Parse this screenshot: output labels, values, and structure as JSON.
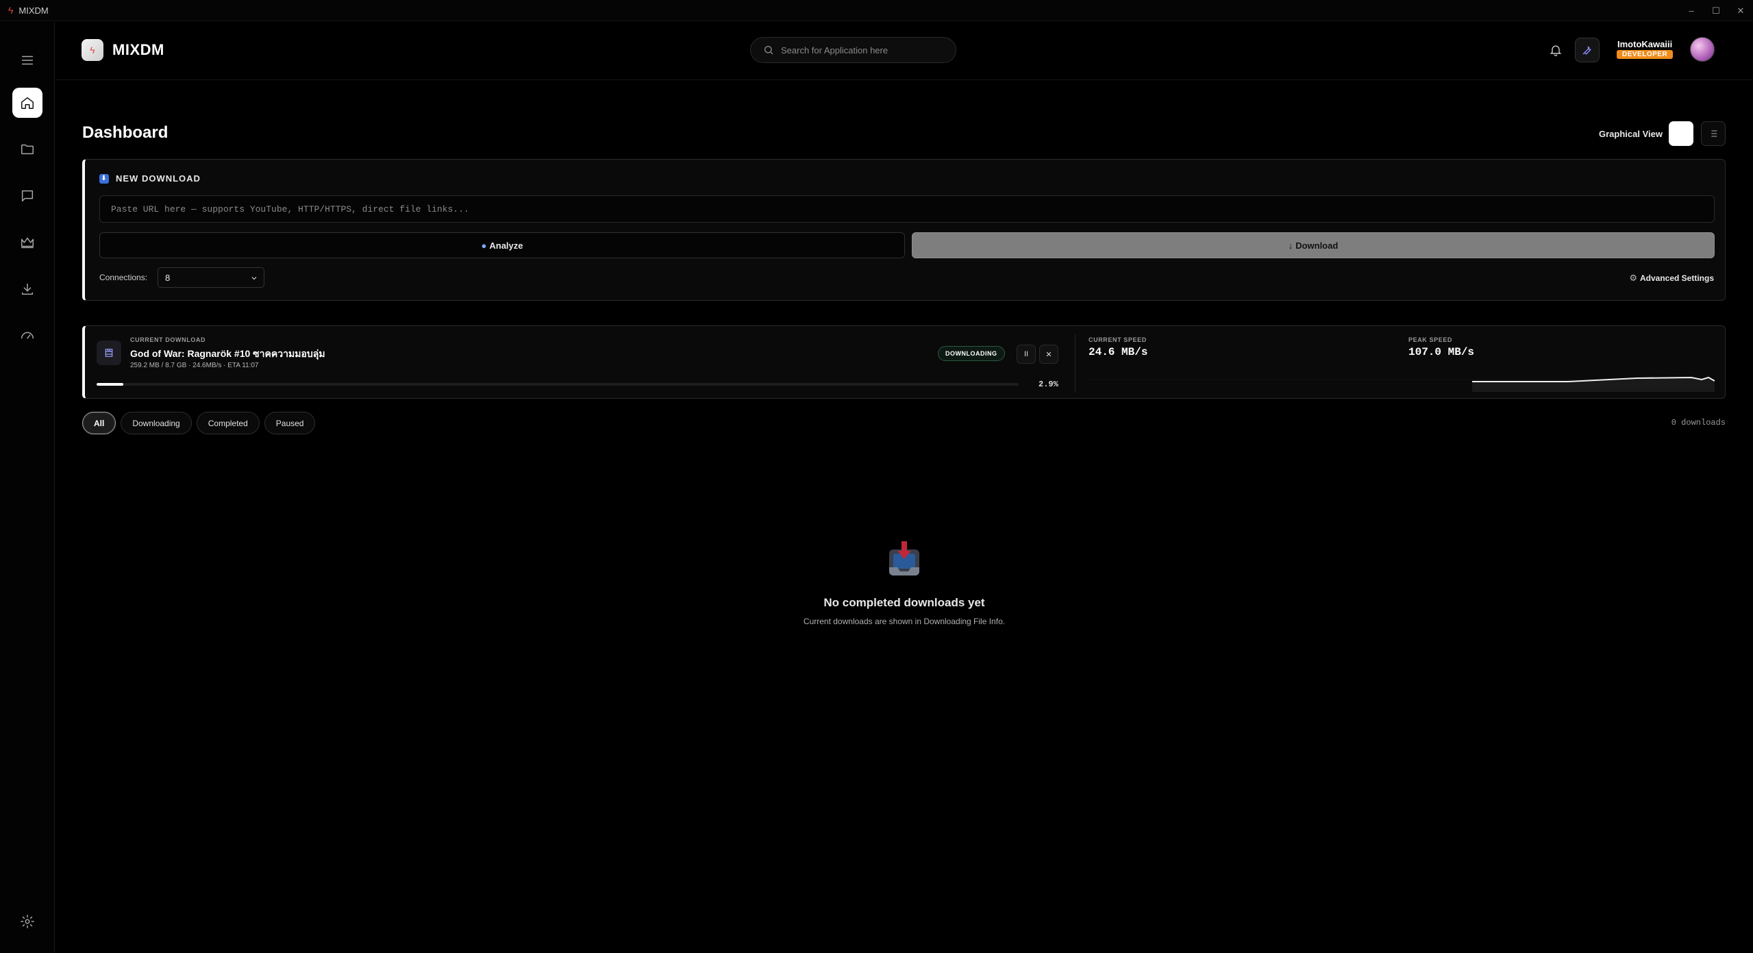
{
  "window": {
    "title": "MIXDM",
    "minimize": "–",
    "maximize": "☐",
    "close": "✕"
  },
  "header": {
    "brand": "MIXDM",
    "search_placeholder": "Search for Application here",
    "user_name": "ImotoKawaiii",
    "user_role": "DEVELOPER"
  },
  "sidebar": {
    "items": [
      "home-icon",
      "folder-icon",
      "chat-icon",
      "crown-icon",
      "download-icon",
      "speedometer-icon"
    ],
    "bottom": "gear-icon"
  },
  "page": {
    "title": "Dashboard",
    "view_label": "Graphical View"
  },
  "new_download": {
    "title": "NEW DOWNLOAD",
    "url_placeholder": "Paste URL here — supports YouTube, HTTP/HTTPS, direct file links...",
    "analyze_label": "Analyze",
    "download_label": "Download",
    "connections_label": "Connections:",
    "connections_value": "8",
    "advanced_label": "Advanced Settings"
  },
  "current_download": {
    "kicker": "CURRENT DOWNLOAD",
    "name": "God of War: Ragnarök #10 ซาคความมอบลุ่ม",
    "meta": "259.2 MB / 8.7 GB · 24.6MB/s · ETA 11:07",
    "status": "DOWNLOADING",
    "progress_percent": 2.9,
    "progress_text": "2.9%",
    "pause_label": "II",
    "cancel_label": "✕",
    "current_speed_label": "CURRENT SPEED",
    "current_speed": "24.6 MB/s",
    "peak_speed_label": "PEAK SPEED",
    "peak_speed": "107.0 MB/s"
  },
  "filters": {
    "all": "All",
    "downloading": "Downloading",
    "completed": "Completed",
    "paused": "Paused",
    "active": "All"
  },
  "downloads_count": "0 downloads",
  "empty_state": {
    "title": "No completed downloads yet",
    "subtitle": "Current downloads are shown in Downloading File Info."
  }
}
